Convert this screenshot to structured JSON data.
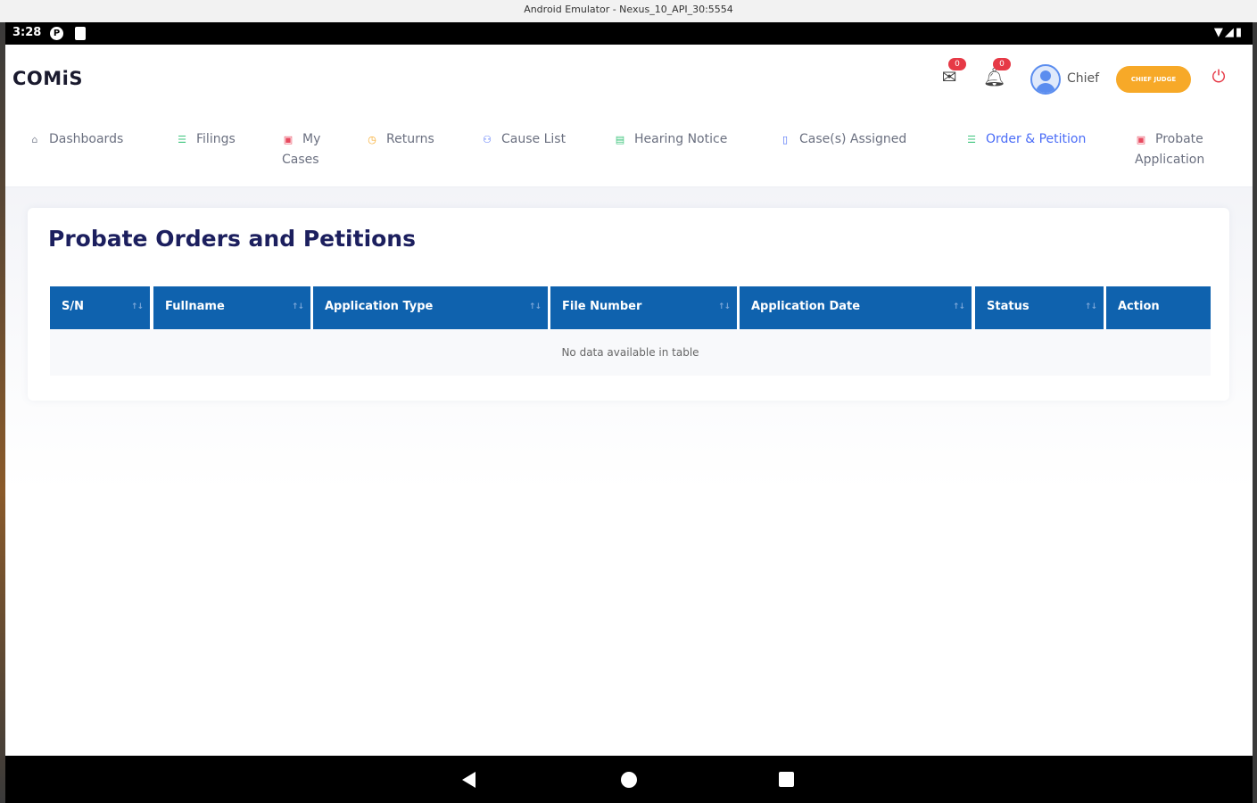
{
  "window": {
    "title": "Android Emulator - Nexus_10_API_30:5554"
  },
  "status_bar": {
    "time": "3:28",
    "icon_p": "P"
  },
  "header": {
    "logo": "COMiS",
    "messages_count": "0",
    "notifications_count": "0",
    "user_name": "Chief",
    "role": "CHIEF JUDGE"
  },
  "nav": {
    "items": [
      {
        "label": "Dashboards",
        "icon": "home-icon",
        "glyph": "⌂",
        "color": "#8a8f9c"
      },
      {
        "label": "Filings",
        "icon": "list-icon",
        "glyph": "☰",
        "color": "#3cc47c"
      },
      {
        "label": "My Cases",
        "line1": "My",
        "line2": "Cases",
        "icon": "folder-icon",
        "glyph": "▣",
        "color": "#e84a5f"
      },
      {
        "label": "Returns",
        "icon": "clock-icon",
        "glyph": "◷",
        "color": "#f7a928"
      },
      {
        "label": "Cause List",
        "icon": "people-icon",
        "glyph": "⚇",
        "color": "#4a6cf7"
      },
      {
        "label": "Hearing Notice",
        "icon": "notice-icon",
        "glyph": "▤",
        "color": "#3cc47c"
      },
      {
        "label": "Case(s) Assigned",
        "icon": "document-icon",
        "glyph": "▯",
        "color": "#4a6cf7"
      },
      {
        "label": "Order & Petition",
        "icon": "list-icon",
        "glyph": "☰",
        "color": "#3cc47c"
      },
      {
        "label": "Probate Application",
        "line1": "Probate",
        "line2": "Application",
        "icon": "folder-icon",
        "glyph": "▣",
        "color": "#e84a5f"
      }
    ]
  },
  "main": {
    "title": "Probate Orders and Petitions",
    "table": {
      "columns": [
        "S/N",
        "Fullname",
        "Application Type",
        "File Number",
        "Application Date",
        "Status",
        "Action"
      ],
      "empty_message": "No data available in table"
    }
  },
  "colors": {
    "table_header": "#0f62ae",
    "role_pill": "#f7a928",
    "badge": "#e63946",
    "active_nav": "#4a6cf7",
    "title": "#1c1f5e"
  }
}
